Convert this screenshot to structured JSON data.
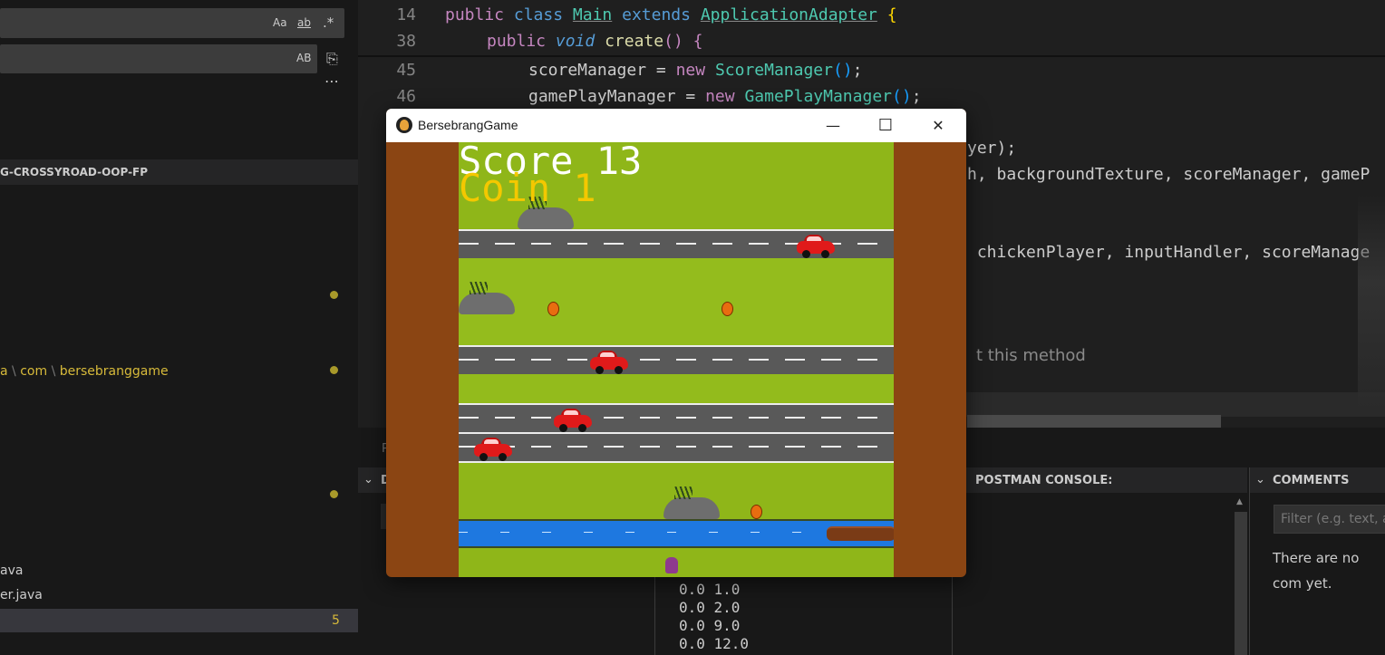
{
  "sidebar": {
    "find": {
      "match_case": "Aa",
      "whole_word": "ab",
      "regex": ".*",
      "preserve_case": "AB",
      "more": "⋯"
    },
    "project_title": "G-CROSSYROAD-OOP-FP",
    "tree_path": [
      "a",
      "com",
      "bersebranggame"
    ],
    "files": [
      "ava",
      "er.java"
    ],
    "selected_badge": "5"
  },
  "editor": {
    "lines": [
      {
        "num": "14",
        "text": "public class Main extends ApplicationAdapter {"
      },
      {
        "num": "38",
        "text": "public void create() {"
      },
      {
        "num": "45",
        "text": "scoreManager = new ScoreManager();"
      },
      {
        "num": "46",
        "text": "gamePlayManager = new GamePlayManager();"
      }
    ],
    "partial_lines": [
      "yer);",
      "h, backgroundTexture, scoreManager, gameP",
      " chickenPlayer, inputHandler, scoreManage"
    ],
    "codelens": "t this method"
  },
  "panels": {
    "left_stub": "D",
    "left_tab_stub": "P",
    "postman": "POSTMAN CONSOLE:",
    "comments": "COMMENTS",
    "filter_placeholder": "Filter (e.g. text, au",
    "no_comments": "There are no com yet.",
    "output": [
      "0.0 1.0",
      "0.0 2.0",
      "0.0 9.0",
      "0.0 12.0"
    ]
  },
  "game": {
    "window_title": "BersebrangGame",
    "minimize": "—",
    "maximize": "☐",
    "close": "✕",
    "score_label": "Score 13",
    "coin_label": "Coin 1"
  }
}
